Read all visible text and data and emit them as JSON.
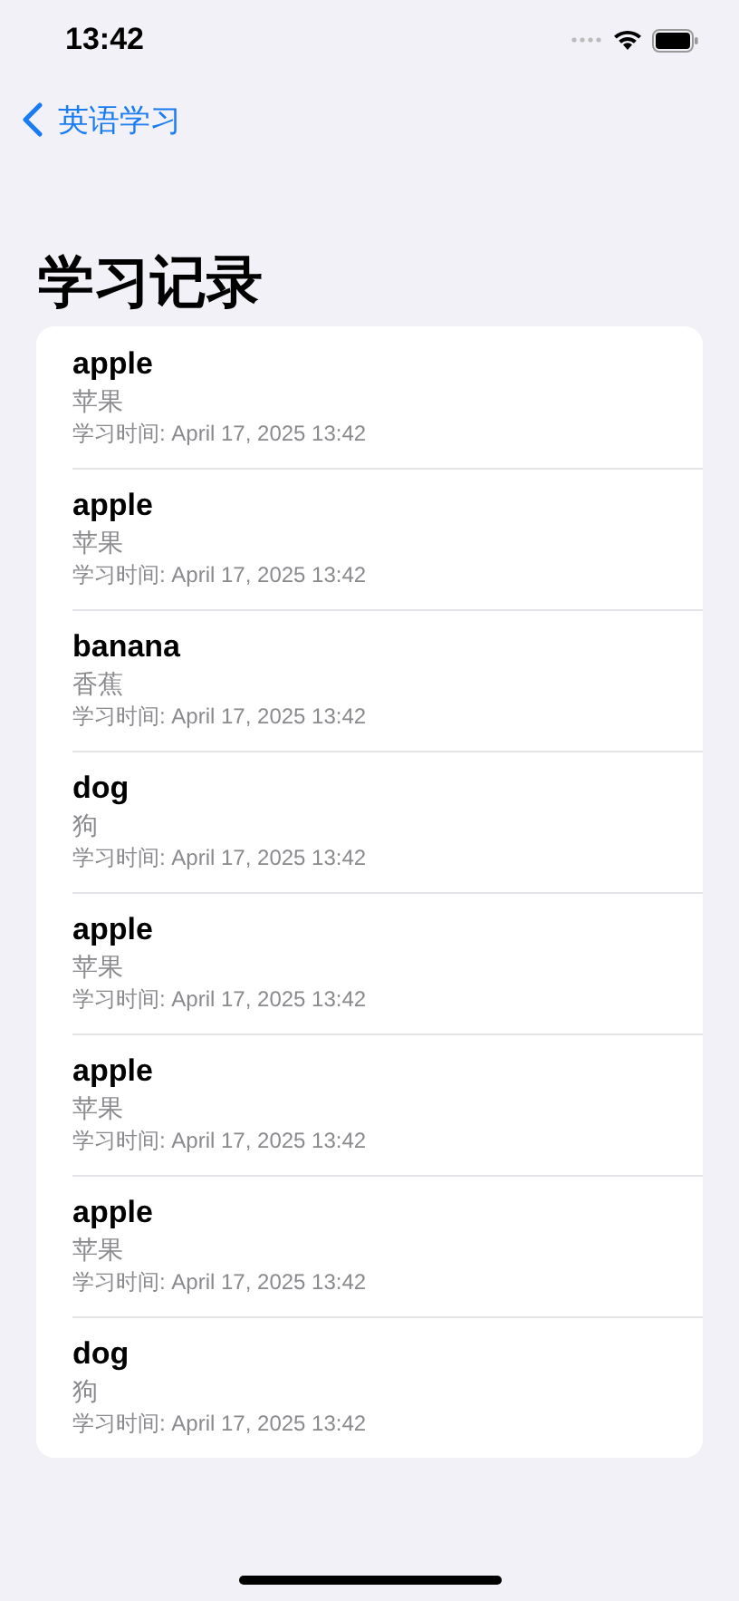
{
  "status_bar": {
    "time": "13:42"
  },
  "nav": {
    "back_label": "英语学习"
  },
  "title": "学习记录",
  "records": [
    {
      "word": "apple",
      "meaning": "苹果",
      "time": "学习时间: April 17, 2025 13:42"
    },
    {
      "word": "apple",
      "meaning": "苹果",
      "time": "学习时间: April 17, 2025 13:42"
    },
    {
      "word": "banana",
      "meaning": "香蕉",
      "time": "学习时间: April 17, 2025 13:42"
    },
    {
      "word": "dog",
      "meaning": "狗",
      "time": "学习时间: April 17, 2025 13:42"
    },
    {
      "word": "apple",
      "meaning": "苹果",
      "time": "学习时间: April 17, 2025 13:42"
    },
    {
      "word": "apple",
      "meaning": "苹果",
      "time": "学习时间: April 17, 2025 13:42"
    },
    {
      "word": "apple",
      "meaning": "苹果",
      "time": "学习时间: April 17, 2025 13:42"
    },
    {
      "word": "dog",
      "meaning": "狗",
      "time": "学习时间: April 17, 2025 13:42"
    }
  ]
}
